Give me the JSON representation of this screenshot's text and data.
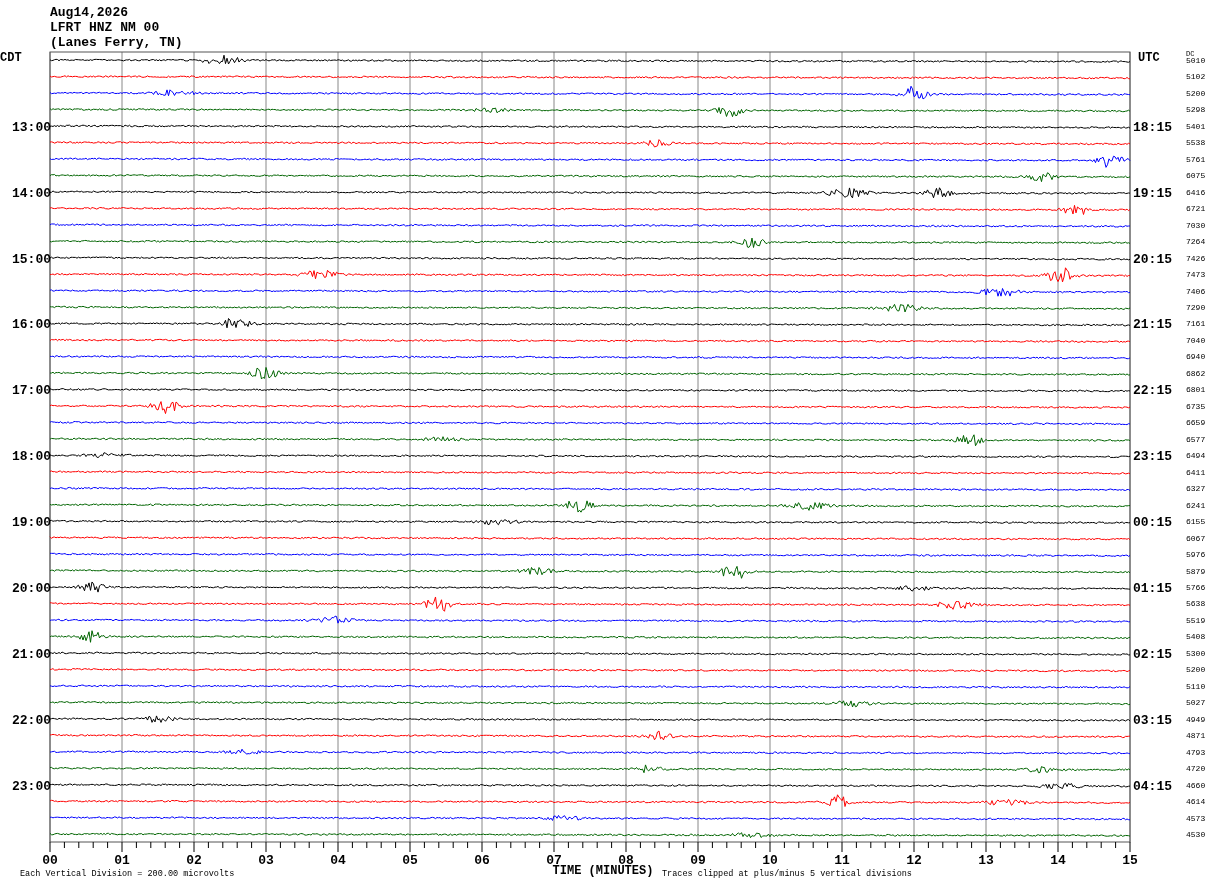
{
  "header": {
    "date": "Aug14,2026",
    "station": "LFRT HNZ NM 00",
    "location": "(Lanes Ferry, TN)"
  },
  "left_zone": "CDT",
  "right_zone": "UTC",
  "dc_header": "DC",
  "traces": [
    {
      "color": "#000000",
      "dc": "5010"
    },
    {
      "color": "#ff0000",
      "dc": "5102"
    },
    {
      "color": "#0000ff",
      "dc": "5200"
    },
    {
      "color": "#006400",
      "dc": "5298"
    },
    {
      "color": "#000000",
      "dc": "5401",
      "cdt": "13:00",
      "utc": "18:15"
    },
    {
      "color": "#ff0000",
      "dc": "5538"
    },
    {
      "color": "#0000ff",
      "dc": "5761"
    },
    {
      "color": "#006400",
      "dc": "6075"
    },
    {
      "color": "#000000",
      "dc": "6416",
      "cdt": "14:00",
      "utc": "19:15"
    },
    {
      "color": "#ff0000",
      "dc": "6721"
    },
    {
      "color": "#0000ff",
      "dc": "7030"
    },
    {
      "color": "#006400",
      "dc": "7264"
    },
    {
      "color": "#000000",
      "dc": "7426",
      "cdt": "15:00",
      "utc": "20:15"
    },
    {
      "color": "#ff0000",
      "dc": "7473"
    },
    {
      "color": "#0000ff",
      "dc": "7406"
    },
    {
      "color": "#006400",
      "dc": "7290"
    },
    {
      "color": "#000000",
      "dc": "7161",
      "cdt": "16:00",
      "utc": "21:15"
    },
    {
      "color": "#ff0000",
      "dc": "7040"
    },
    {
      "color": "#0000ff",
      "dc": "6940"
    },
    {
      "color": "#006400",
      "dc": "6862"
    },
    {
      "color": "#000000",
      "dc": "6801",
      "cdt": "17:00",
      "utc": "22:15"
    },
    {
      "color": "#ff0000",
      "dc": "6735"
    },
    {
      "color": "#0000ff",
      "dc": "6659"
    },
    {
      "color": "#006400",
      "dc": "6577"
    },
    {
      "color": "#000000",
      "dc": "6494",
      "cdt": "18:00",
      "utc": "23:15"
    },
    {
      "color": "#ff0000",
      "dc": "6411"
    },
    {
      "color": "#0000ff",
      "dc": "6327"
    },
    {
      "color": "#006400",
      "dc": "6241"
    },
    {
      "color": "#000000",
      "dc": "6155",
      "cdt": "19:00",
      "utc": "00:15"
    },
    {
      "color": "#ff0000",
      "dc": "6067"
    },
    {
      "color": "#0000ff",
      "dc": "5976"
    },
    {
      "color": "#006400",
      "dc": "5879"
    },
    {
      "color": "#000000",
      "dc": "5766",
      "cdt": "20:00",
      "utc": "01:15"
    },
    {
      "color": "#ff0000",
      "dc": "5638"
    },
    {
      "color": "#0000ff",
      "dc": "5519"
    },
    {
      "color": "#006400",
      "dc": "5408"
    },
    {
      "color": "#000000",
      "dc": "5300",
      "cdt": "21:00",
      "utc": "02:15"
    },
    {
      "color": "#ff0000",
      "dc": "5200"
    },
    {
      "color": "#0000ff",
      "dc": "5110"
    },
    {
      "color": "#006400",
      "dc": "5027"
    },
    {
      "color": "#000000",
      "dc": "4949",
      "cdt": "22:00",
      "utc": "03:15"
    },
    {
      "color": "#ff0000",
      "dc": "4871"
    },
    {
      "color": "#0000ff",
      "dc": "4793"
    },
    {
      "color": "#006400",
      "dc": "4720"
    },
    {
      "color": "#000000",
      "dc": "4660",
      "cdt": "23:00",
      "utc": "04:15"
    },
    {
      "color": "#ff0000",
      "dc": "4614"
    },
    {
      "color": "#0000ff",
      "dc": "4573"
    },
    {
      "color": "#006400",
      "dc": "4530"
    }
  ],
  "x_axis": {
    "tick_labels": [
      "00",
      "01",
      "02",
      "03",
      "04",
      "05",
      "06",
      "07",
      "08",
      "09",
      "10",
      "11",
      "12",
      "13",
      "14",
      "15"
    ],
    "title": "TIME (MINUTES)"
  },
  "footer": {
    "scale_note": "Each Vertical Division =  200.00 microvolts",
    "clip_note": "Traces clipped at plus/minus 5 vertical divisions"
  }
}
